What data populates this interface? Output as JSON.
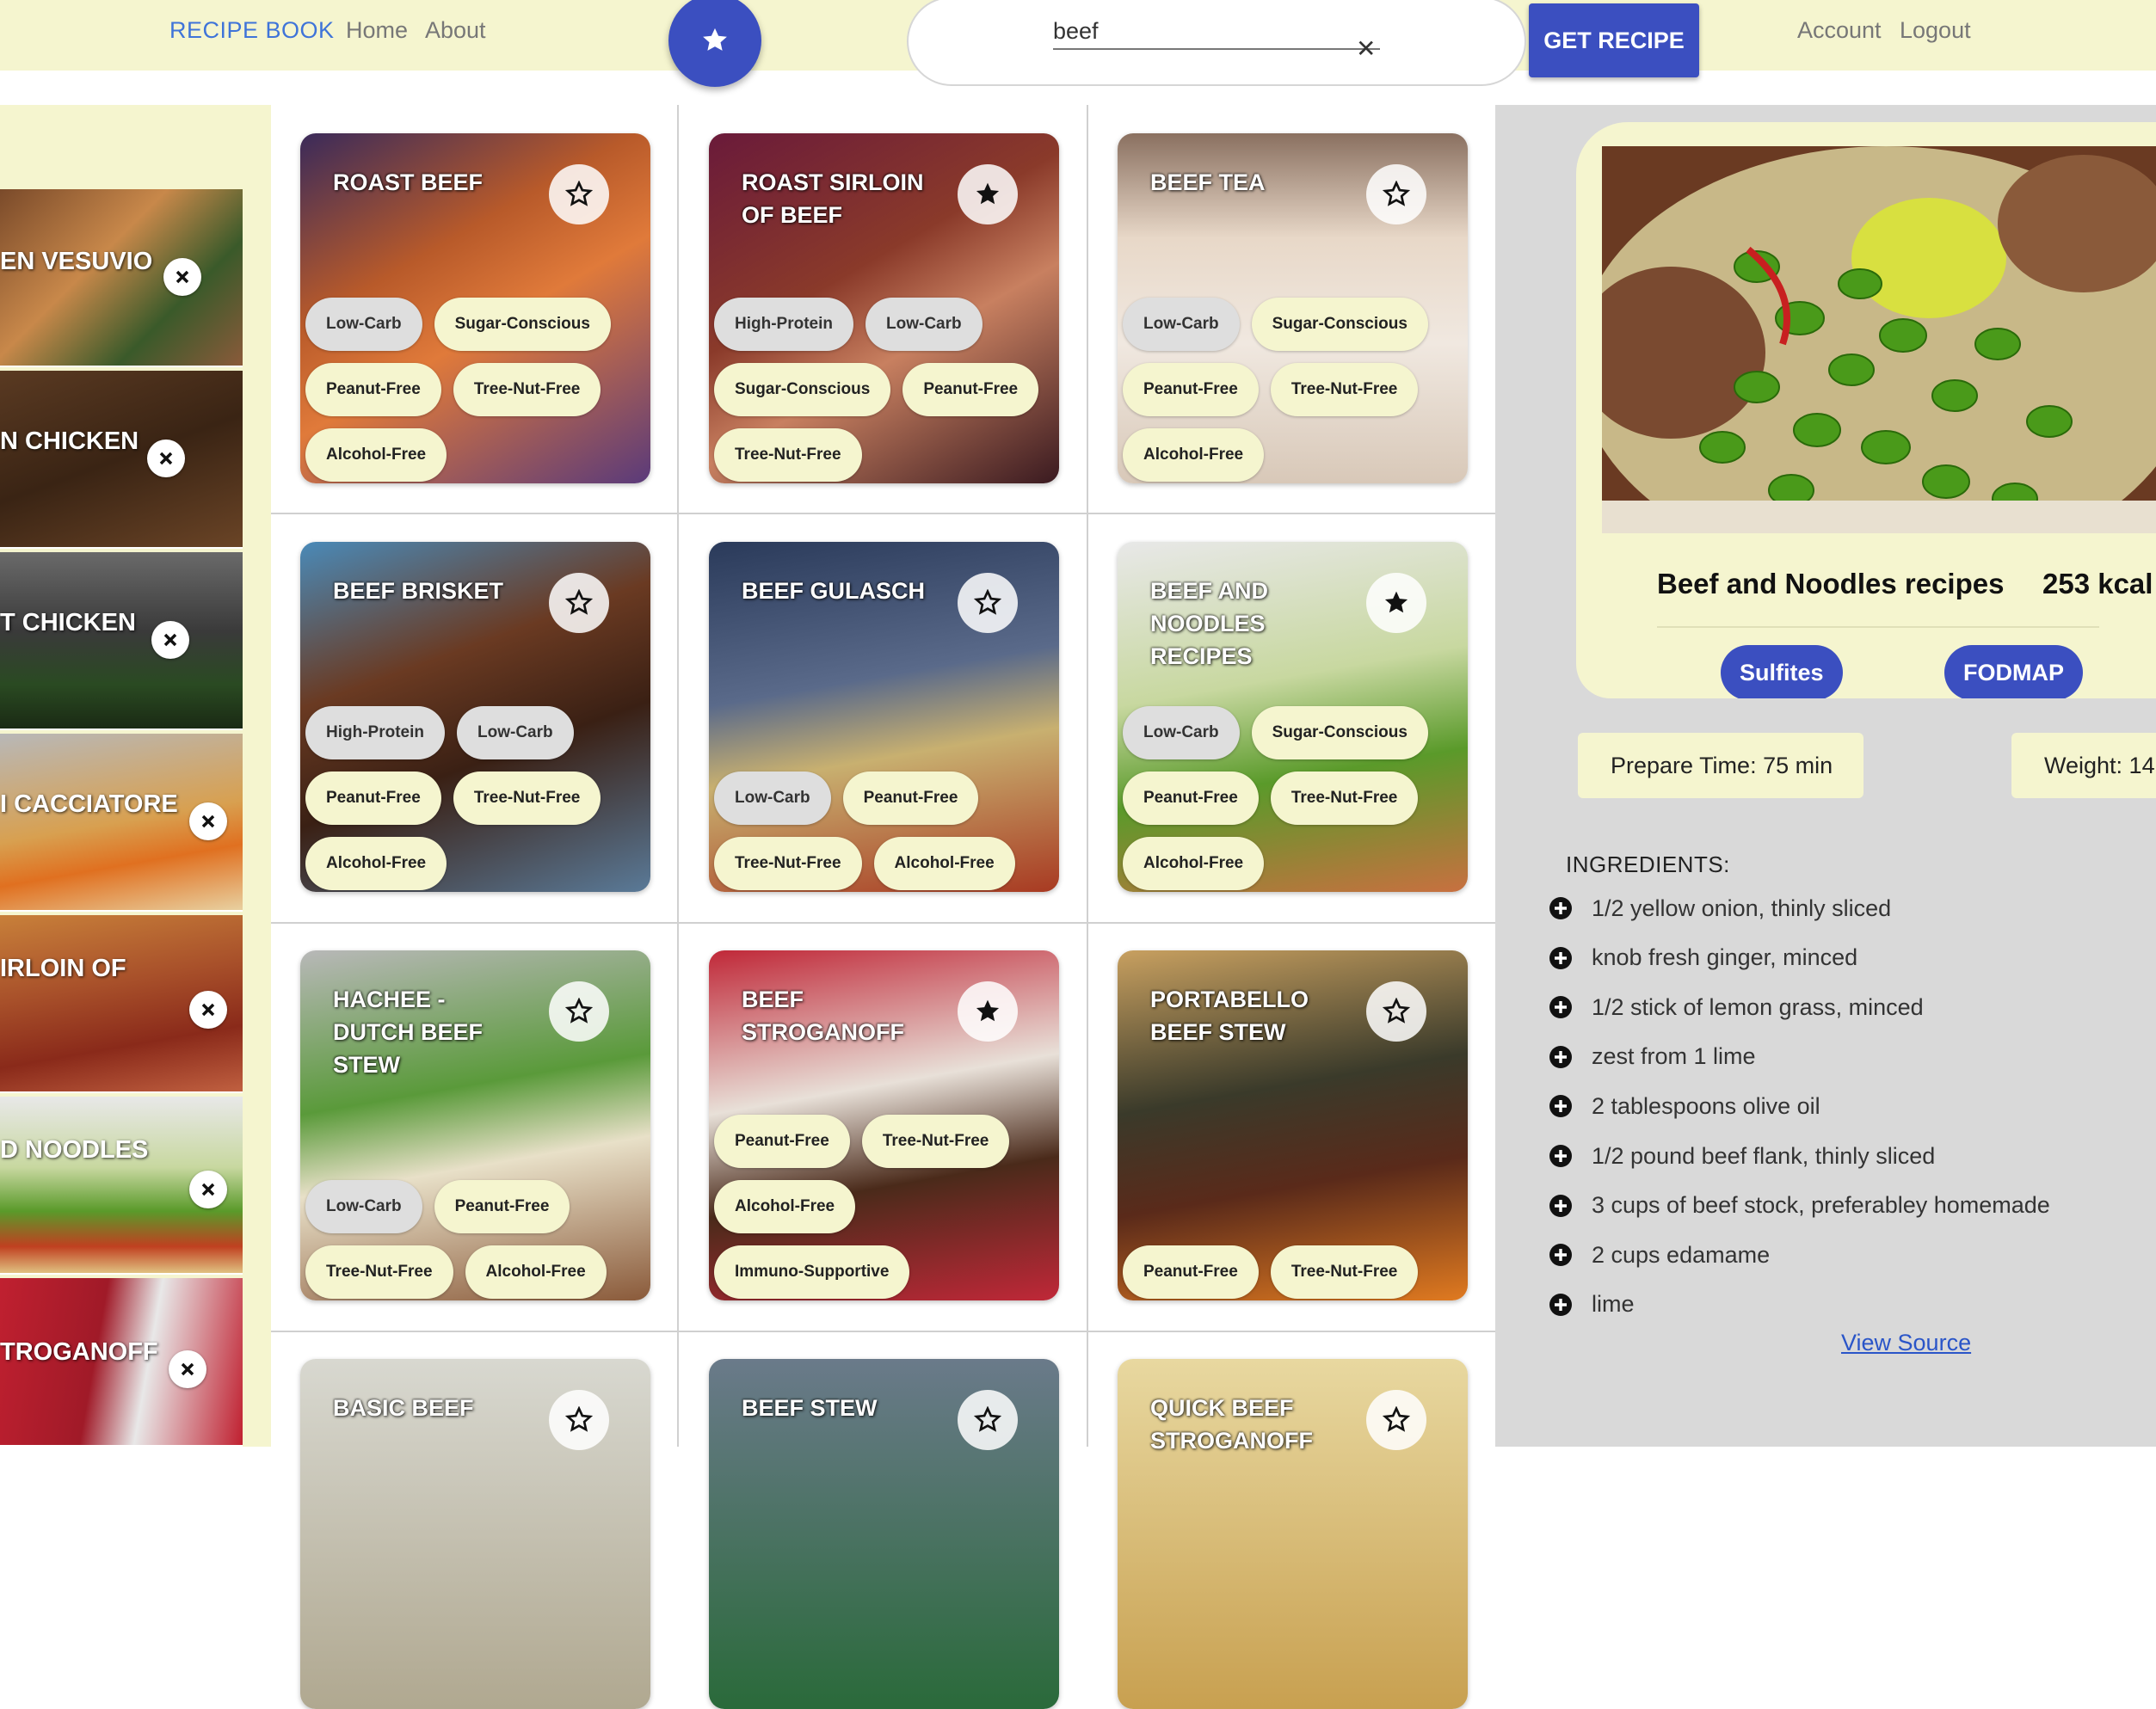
{
  "header": {
    "brand": "RECIPE BOOK",
    "nav": [
      "Home",
      "About"
    ],
    "search": {
      "value": "beef"
    },
    "get_recipe_label": "GET RECIPE",
    "account_links": [
      "Account",
      "Logout"
    ]
  },
  "sidebar": {
    "items": [
      {
        "title": "EN VESUVIO"
      },
      {
        "title": "N CHICKEN"
      },
      {
        "title": "T CHICKEN"
      },
      {
        "title": "I CACCIATORE"
      },
      {
        "title": "IRLOIN OF"
      },
      {
        "title": "D NOODLES"
      },
      {
        "title": "TROGANOFF"
      }
    ]
  },
  "recipes": [
    {
      "title": "ROAST BEEF",
      "starred": false,
      "tags": [
        "Low-Carb",
        "Sugar-Conscious",
        "Peanut-Free",
        "Tree-Nut-Free",
        "Alcohol-Free"
      ]
    },
    {
      "title": "ROAST SIRLOIN OF BEEF",
      "starred": true,
      "tags": [
        "High-Protein",
        "Low-Carb",
        "Sugar-Conscious",
        "Peanut-Free",
        "Tree-Nut-Free"
      ]
    },
    {
      "title": "BEEF TEA",
      "starred": false,
      "tags": [
        "Low-Carb",
        "Sugar-Conscious",
        "Peanut-Free",
        "Tree-Nut-Free",
        "Alcohol-Free"
      ]
    },
    {
      "title": "BEEF BRISKET",
      "starred": false,
      "tags": [
        "High-Protein",
        "Low-Carb",
        "Peanut-Free",
        "Tree-Nut-Free",
        "Alcohol-Free"
      ]
    },
    {
      "title": "BEEF GULASCH",
      "starred": false,
      "tags": [
        "Low-Carb",
        "Peanut-Free",
        "Tree-Nut-Free",
        "Alcohol-Free"
      ]
    },
    {
      "title": "BEEF AND NOODLES RECIPES",
      "starred": true,
      "tags": [
        "Low-Carb",
        "Sugar-Conscious",
        "Peanut-Free",
        "Tree-Nut-Free",
        "Alcohol-Free"
      ]
    },
    {
      "title": "HACHEE - DUTCH BEEF STEW",
      "starred": false,
      "tags": [
        "Low-Carb",
        "Peanut-Free",
        "Tree-Nut-Free",
        "Alcohol-Free"
      ]
    },
    {
      "title": "BEEF STROGANOFF",
      "starred": true,
      "tags": [
        "Peanut-Free",
        "Tree-Nut-Free",
        "Alcohol-Free",
        "Immuno-Supportive"
      ]
    },
    {
      "title": "PORTABELLO BEEF STEW",
      "starred": false,
      "tags": [
        "Peanut-Free",
        "Tree-Nut-Free"
      ]
    },
    {
      "title": "BASIC BEEF",
      "starred": false,
      "tags": []
    },
    {
      "title": "BEEF STEW",
      "starred": false,
      "tags": []
    },
    {
      "title": "QUICK BEEF STROGANOFF",
      "starred": false,
      "tags": []
    }
  ],
  "detail": {
    "title": "Beef and Noodles recipes",
    "kcal": "253 kcal",
    "cautions": [
      "Sulfites",
      "FODMAP"
    ],
    "prepare_time": "Prepare Time: 75 min",
    "weight": "Weight: 14",
    "ingredients_heading": "INGREDIENTS:",
    "ingredients": [
      "1/2 yellow onion, thinly sliced",
      "knob fresh ginger, minced",
      "1/2 stick of lemon grass, minced",
      "zest from 1 lime",
      "2 tablespoons olive oil",
      "1/2 pound beef flank, thinly sliced",
      "3 cups of beef stock, preferabley homemade",
      "2 cups edamame",
      "lime"
    ],
    "view_source": "View Source"
  },
  "colors": {
    "accent": "#3b4fc0",
    "cream": "#f5f5cf",
    "link": "#3f74d9",
    "panel": "#d9d9d9"
  }
}
